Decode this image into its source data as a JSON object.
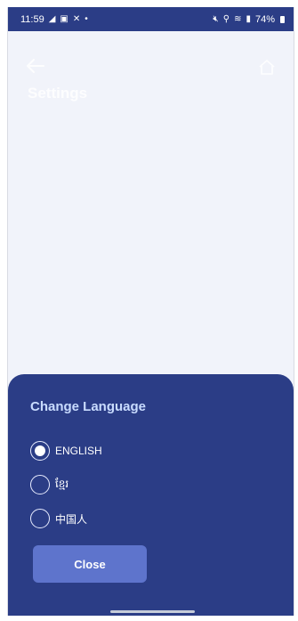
{
  "status_bar": {
    "time": "11:59",
    "left_icons": [
      "telegram-icon",
      "gallery-icon",
      "x-icon",
      "dot-icon"
    ],
    "right_icons": [
      "mute-icon",
      "location-icon",
      "wifi-icon",
      "signal-icon"
    ],
    "battery": "74%"
  },
  "header": {
    "title": "Settings",
    "back_icon": "arrow-left-icon",
    "home_icon": "home-icon"
  },
  "language_sheet": {
    "title": "Change Language",
    "options": [
      {
        "label": "ENGLISH",
        "selected": true
      },
      {
        "label": "ខ្មែរ",
        "selected": false
      },
      {
        "label": "中国人",
        "selected": false
      }
    ],
    "close_label": "Close"
  },
  "colors": {
    "status_bar": "#2b3d86",
    "background": "#f1f3fa",
    "sheet": "#2b3d86",
    "sheet_title": "#c9dcff",
    "button": "#5e74cc"
  }
}
